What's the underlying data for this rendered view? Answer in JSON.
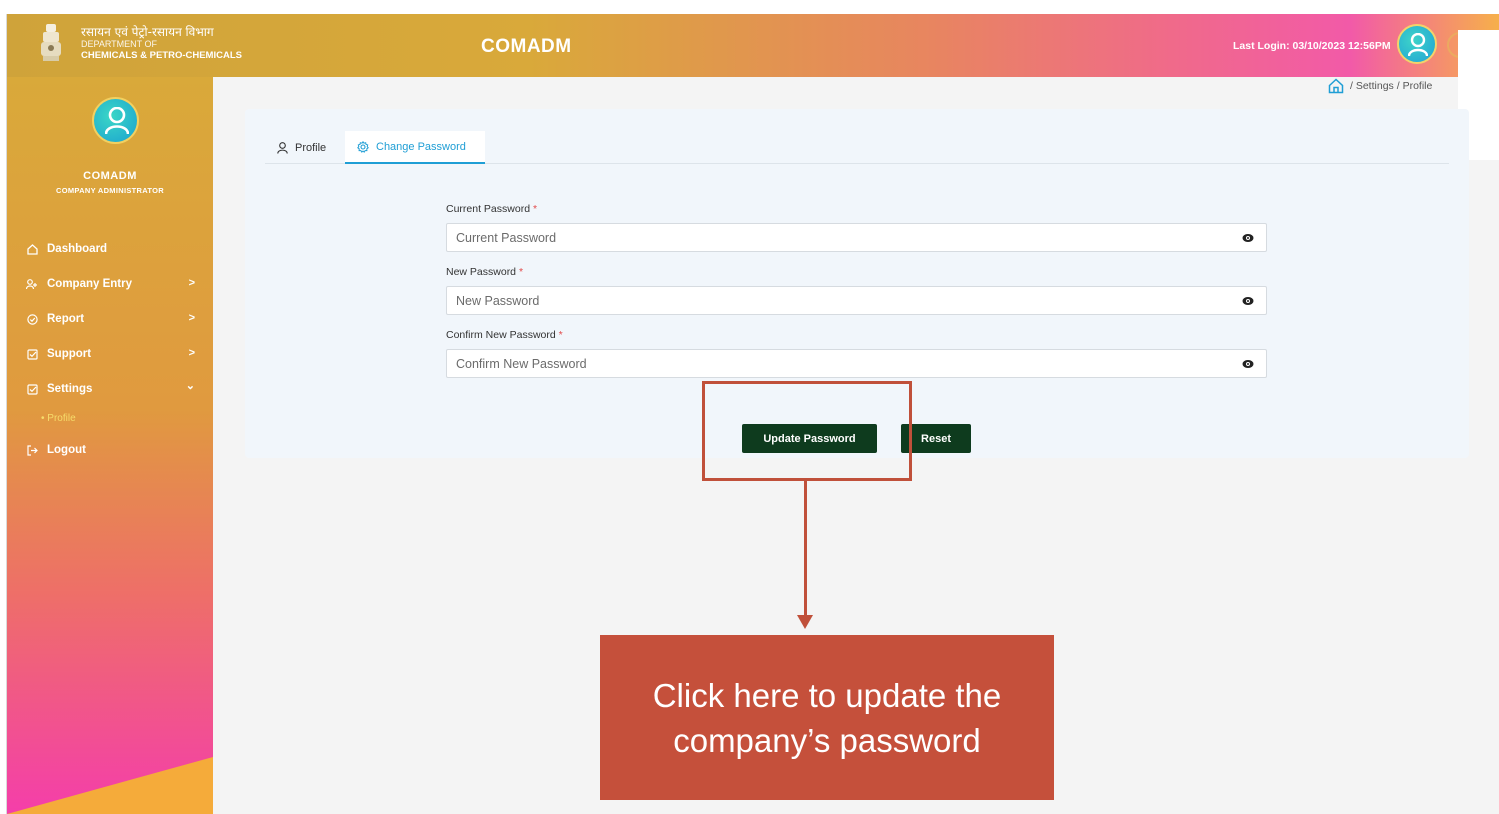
{
  "header": {
    "dept_hindi": "रसायन एवं पेट्रो-रसायन विभाग",
    "dept_of": "DEPARTMENT OF",
    "dept_name": "CHEMICALS & PETRO-CHEMICALS",
    "app_title": "COMADM",
    "last_login": "Last Login: 03/10/2023 12:56PM"
  },
  "sidebar": {
    "user_name": "COMADM",
    "user_role": "COMPANY ADMINISTRATOR",
    "items": [
      {
        "label": "Dashboard",
        "icon": "home-icon"
      },
      {
        "label": "Company Entry",
        "icon": "user-plus-icon",
        "chevron": ">"
      },
      {
        "label": "Report",
        "icon": "check-circle-icon",
        "chevron": ">"
      },
      {
        "label": "Support",
        "icon": "checkbox-icon",
        "chevron": ">"
      },
      {
        "label": "Settings",
        "icon": "checkbox-icon",
        "chevron": "⌄"
      },
      {
        "label": "Logout",
        "icon": "logout-icon"
      }
    ],
    "sub_item": "• Profile"
  },
  "breadcrumb": {
    "sep1": "/",
    "settings": "Settings",
    "sep2": "/",
    "profile": "Profile"
  },
  "tabs": {
    "profile": "Profile",
    "change_password": "Change Password"
  },
  "form": {
    "current_label": "Current Password",
    "current_placeholder": "Current Password",
    "new_label": "New Password",
    "new_placeholder": "New Password",
    "confirm_label": "Confirm New Password",
    "confirm_placeholder": "Confirm New Password",
    "required_mark": "*",
    "update_button": "Update Password",
    "reset_button": "Reset"
  },
  "annotation": {
    "callout_text": "Click here to update the company’s password",
    "color": "#c5503b"
  }
}
